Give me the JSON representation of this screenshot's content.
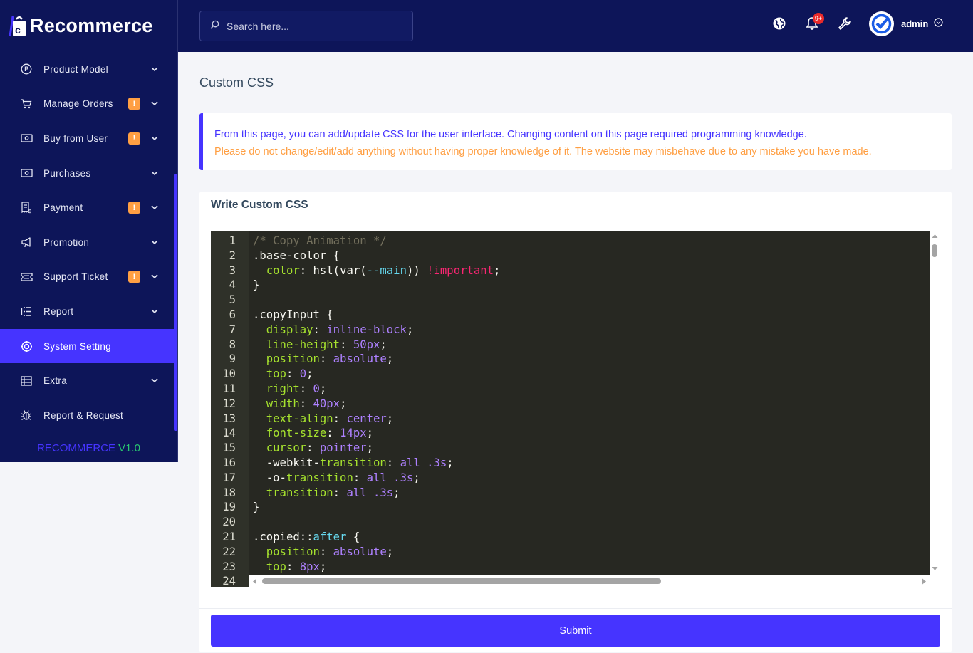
{
  "brand": {
    "name": "Recommerce"
  },
  "search": {
    "placeholder": "Search here..."
  },
  "topbar": {
    "notification_count": "9+",
    "user_name": "admin"
  },
  "sidebar": {
    "items": [
      {
        "label": "Product Model",
        "icon": "product-icon",
        "badge": "",
        "chevron": true
      },
      {
        "label": "Manage Orders",
        "icon": "cart-icon",
        "badge": "!",
        "chevron": true
      },
      {
        "label": "Buy from User",
        "icon": "money-icon",
        "badge": "!",
        "chevron": true
      },
      {
        "label": "Purchases",
        "icon": "money-icon",
        "badge": "",
        "chevron": true
      },
      {
        "label": "Payment",
        "icon": "receipt-icon",
        "badge": "!",
        "chevron": true
      },
      {
        "label": "Promotion",
        "icon": "megaphone-icon",
        "badge": "",
        "chevron": true
      },
      {
        "label": "Support Ticket",
        "icon": "ticket-icon",
        "badge": "!",
        "chevron": true
      },
      {
        "label": "Report",
        "icon": "list-icon",
        "badge": "",
        "chevron": true
      },
      {
        "label": "System Setting",
        "icon": "gear-icon",
        "badge": "",
        "chevron": false,
        "active": true
      },
      {
        "label": "Extra",
        "icon": "table-icon",
        "badge": "",
        "chevron": true
      },
      {
        "label": "Report & Request",
        "icon": "bug-icon",
        "badge": "",
        "chevron": false
      }
    ],
    "version_name": "RECOMMERCE",
    "version_number": "V1.0"
  },
  "page": {
    "title": "Custom CSS",
    "notice_line1": "From this page, you can add/update CSS for the user interface. Changing content on this page required programming knowledge.",
    "notice_line2": "Please do not change/edit/add anything without having proper knowledge of it. The website may misbehave due to any mistake you have made.",
    "card_title": "Write Custom CSS",
    "submit_label": "Submit"
  },
  "editor": {
    "lines": [
      [
        [
          "c-comment",
          "/* Copy Animation */"
        ]
      ],
      [
        [
          "c-sel",
          ".base-color {"
        ]
      ],
      [
        [
          "",
          "  "
        ],
        [
          "c-prop",
          "color"
        ],
        [
          "",
          ": hsl(var("
        ],
        [
          "c-var",
          "--main"
        ],
        [
          "",
          ")) "
        ],
        [
          "c-imp",
          "!important"
        ],
        [
          "",
          ";"
        ]
      ],
      [
        [
          "",
          "}"
        ]
      ],
      [
        [
          "",
          ""
        ]
      ],
      [
        [
          "c-sel",
          ".copyInput {"
        ]
      ],
      [
        [
          "",
          "  "
        ],
        [
          "c-prop",
          "display"
        ],
        [
          "",
          ": "
        ],
        [
          "c-val",
          "inline-block"
        ],
        [
          "",
          ";"
        ]
      ],
      [
        [
          "",
          "  "
        ],
        [
          "c-prop",
          "line-height"
        ],
        [
          "",
          ": "
        ],
        [
          "c-val",
          "50px"
        ],
        [
          "",
          ";"
        ]
      ],
      [
        [
          "",
          "  "
        ],
        [
          "c-prop",
          "position"
        ],
        [
          "",
          ": "
        ],
        [
          "c-val",
          "absolute"
        ],
        [
          "",
          ";"
        ]
      ],
      [
        [
          "",
          "  "
        ],
        [
          "c-prop",
          "top"
        ],
        [
          "",
          ": "
        ],
        [
          "c-val",
          "0"
        ],
        [
          "",
          ";"
        ]
      ],
      [
        [
          "",
          "  "
        ],
        [
          "c-prop",
          "right"
        ],
        [
          "",
          ": "
        ],
        [
          "c-val",
          "0"
        ],
        [
          "",
          ";"
        ]
      ],
      [
        [
          "",
          "  "
        ],
        [
          "c-prop",
          "width"
        ],
        [
          "",
          ": "
        ],
        [
          "c-val",
          "40px"
        ],
        [
          "",
          ";"
        ]
      ],
      [
        [
          "",
          "  "
        ],
        [
          "c-prop",
          "text-align"
        ],
        [
          "",
          ": "
        ],
        [
          "c-val",
          "center"
        ],
        [
          "",
          ";"
        ]
      ],
      [
        [
          "",
          "  "
        ],
        [
          "c-prop",
          "font-size"
        ],
        [
          "",
          ": "
        ],
        [
          "c-val",
          "14px"
        ],
        [
          "",
          ";"
        ]
      ],
      [
        [
          "",
          "  "
        ],
        [
          "c-prop",
          "cursor"
        ],
        [
          "",
          ": "
        ],
        [
          "c-val",
          "pointer"
        ],
        [
          "",
          ";"
        ]
      ],
      [
        [
          "",
          "  -webkit-"
        ],
        [
          "c-prop",
          "transition"
        ],
        [
          "",
          ": "
        ],
        [
          "c-val",
          "all .3s"
        ],
        [
          "",
          ";"
        ]
      ],
      [
        [
          "",
          "  -o-"
        ],
        [
          "c-prop",
          "transition"
        ],
        [
          "",
          ": "
        ],
        [
          "c-val",
          "all .3s"
        ],
        [
          "",
          ";"
        ]
      ],
      [
        [
          "",
          "  "
        ],
        [
          "c-prop",
          "transition"
        ],
        [
          "",
          ": "
        ],
        [
          "c-val",
          "all .3s"
        ],
        [
          "",
          ";"
        ]
      ],
      [
        [
          "",
          "}"
        ]
      ],
      [
        [
          "",
          ""
        ]
      ],
      [
        [
          "c-sel",
          ".copied::"
        ],
        [
          "c-var",
          "after"
        ],
        [
          "",
          " {"
        ]
      ],
      [
        [
          "",
          "  "
        ],
        [
          "c-prop",
          "position"
        ],
        [
          "",
          ": "
        ],
        [
          "c-val",
          "absolute"
        ],
        [
          "",
          ";"
        ]
      ],
      [
        [
          "",
          "  "
        ],
        [
          "c-prop",
          "top"
        ],
        [
          "",
          ": "
        ],
        [
          "c-val",
          "8px"
        ],
        [
          "",
          ";"
        ]
      ],
      [
        [
          "",
          ""
        ]
      ]
    ]
  },
  "colors": {
    "accent": "#4634ff",
    "navy": "#0d1559",
    "warning": "#ff9f43",
    "editor_bg": "#272822"
  }
}
